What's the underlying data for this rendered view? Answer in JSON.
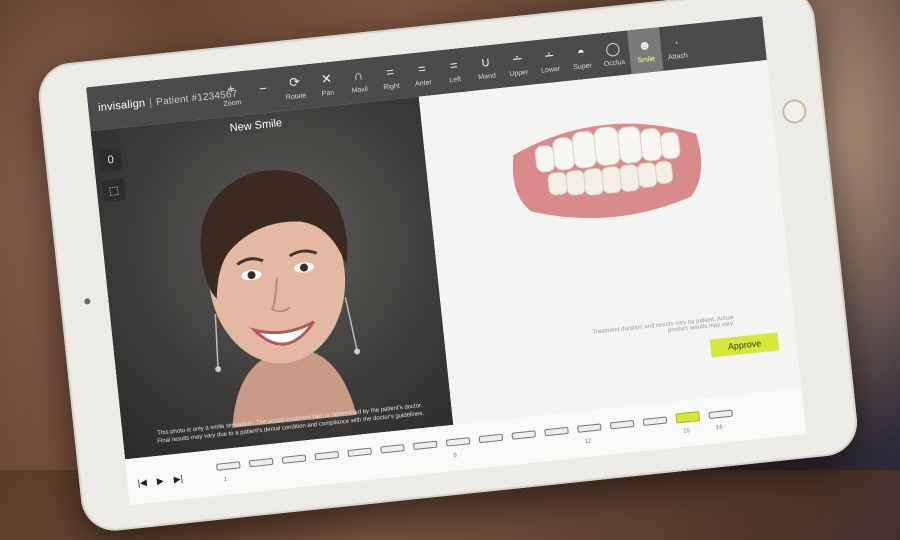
{
  "app": {
    "brand": "invisalign",
    "patient": "Patient #1234567"
  },
  "toolbar": {
    "tools": [
      {
        "label": "Zoom",
        "icon": "+"
      },
      {
        "label": "",
        "icon": "−"
      },
      {
        "label": "Rotate",
        "icon": "⟳"
      },
      {
        "label": "Pan",
        "icon": "✕"
      },
      {
        "label": "Maxil",
        "icon": "∩"
      },
      {
        "label": "Right",
        "icon": "="
      },
      {
        "label": "Anter",
        "icon": "="
      },
      {
        "label": "Left",
        "icon": "="
      },
      {
        "label": "Mand",
        "icon": "∪"
      },
      {
        "label": "Upper",
        "icon": "∸"
      },
      {
        "label": "Lower",
        "icon": "∸"
      },
      {
        "label": "Super",
        "icon": "◓"
      },
      {
        "label": "Occlus",
        "icon": "◯"
      },
      {
        "label": "Smile",
        "icon": "☻"
      },
      {
        "label": "Attach",
        "icon": "·"
      }
    ],
    "active_tool": "Smile"
  },
  "photo_pane": {
    "title": "New Smile",
    "side_buttons": [
      "0",
      "⬚"
    ],
    "disclaimer": "This photo is only a smile simulation. The actual treatment plan is determined by the patient's doctor. Final results may vary due to a patient's dental condition and compliance with the doctor's guidelines."
  },
  "model_pane": {
    "note": "Treatment duration and results vary by patient. Actual product results may vary.",
    "approve_label": "Approve"
  },
  "timeline": {
    "controls": [
      "|◀",
      "▶",
      "▶|"
    ],
    "stage_count": 16,
    "current_stage": 15,
    "labels": [
      "1",
      "8",
      "12",
      "15",
      "16"
    ]
  },
  "colors": {
    "accent": "#d7e63a",
    "toolbar": "#4b4b4b"
  }
}
